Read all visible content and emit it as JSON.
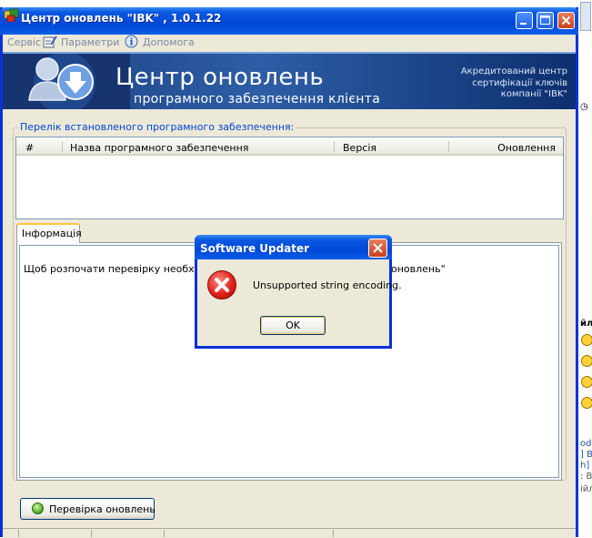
{
  "window": {
    "title": "Центр оновлень \"IBK\" , 1.0.1.22"
  },
  "menu": {
    "items": [
      "Сервіс",
      "Параметри",
      "Допомога"
    ]
  },
  "banner": {
    "title": "Центр оновлень",
    "subtitle": "програмного забезпечення клієнта",
    "right_lines": [
      "Акредитований центр",
      "сертифікації ключів",
      "компанії \"IBK\""
    ]
  },
  "software_list": {
    "legend": "Перелік встановленого програмного забезпечення:",
    "columns": [
      "#",
      "Назва програмного забезпечення",
      "Версія",
      "Оновлення"
    ],
    "rows": []
  },
  "tabs": {
    "items": [
      "Інформація"
    ]
  },
  "info": {
    "text_left": "Щоб розпочати перевірку необхідно",
    "text_right": "оновлень\""
  },
  "actions": {
    "check_updates_label": "Перевірка оновлень"
  },
  "dialog": {
    "title": "Software Updater",
    "message": "Unsupported string encoding.",
    "ok_label": "OK"
  },
  "background_window": {
    "fragments": [
      "йл",
      "od",
      "] В",
      "h]",
      ": Ві",
      "ійл"
    ]
  },
  "colors": {
    "titlebar": "#0a58e0",
    "banner": "#1e3f82",
    "legend_text": "#0046d5",
    "error_icon": "#e0231b"
  }
}
